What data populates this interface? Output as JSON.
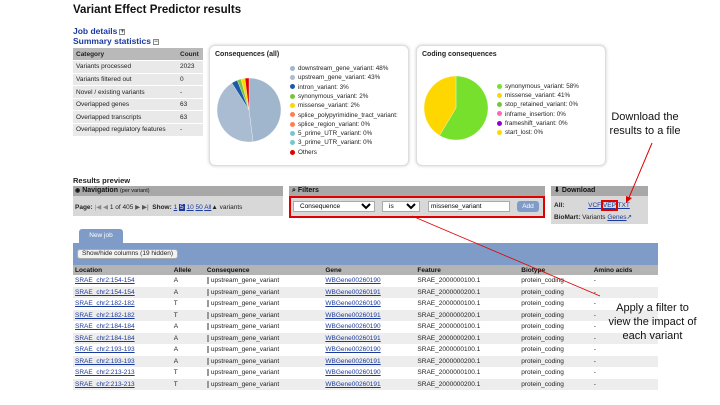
{
  "page_title": "Variant Effect Predictor results",
  "job_details_label": "Job details",
  "summary_label": "Summary statistics",
  "stats": {
    "headers": [
      "Category",
      "Count"
    ],
    "rows": [
      [
        "Variants processed",
        "2023"
      ],
      [
        "Variants filtered out",
        "0"
      ],
      [
        "Novel / existing variants",
        "-"
      ],
      [
        "Overlapped genes",
        "63"
      ],
      [
        "Overlapped transcripts",
        "63"
      ],
      [
        "Overlapped regulatory features",
        "-"
      ]
    ]
  },
  "consequences_all": {
    "title": "Consequences (all)",
    "legend": [
      {
        "label": "downstream_gene_variant: 48%",
        "color": "#9fb6cd"
      },
      {
        "label": "upstream_gene_variant: 43%",
        "color": "#a9bcd1"
      },
      {
        "label": "intron_variant: 3%",
        "color": "#1c5aa8"
      },
      {
        "label": "synonymous_variant: 2%",
        "color": "#76c442"
      },
      {
        "label": "missense_variant: 2%",
        "color": "#ffd700"
      },
      {
        "label": "splice_polypyrimidine_tract_variant:",
        "color": "#ff7f50"
      },
      {
        "label": "splice_region_variant: 0%",
        "color": "#ff7f50"
      },
      {
        "label": "5_prime_UTR_variant: 0%",
        "color": "#7ac5cd"
      },
      {
        "label": "3_prime_UTR_variant: 0%",
        "color": "#7ac5cd"
      },
      {
        "label": "Others",
        "color": "#e00000"
      }
    ],
    "chart_data": {
      "type": "pie",
      "labels": [
        "downstream_gene_variant",
        "upstream_gene_variant",
        "intron_variant",
        "synonymous_variant",
        "missense_variant",
        "Others"
      ],
      "values": [
        48,
        43,
        3,
        2,
        2,
        2
      ]
    }
  },
  "coding_consequences": {
    "title": "Coding consequences",
    "legend": [
      {
        "label": "synonymous_variant: 58%",
        "color": "#76e02c"
      },
      {
        "label": "missense_variant: 41%",
        "color": "#ffd700"
      },
      {
        "label": "stop_retained_variant: 0%",
        "color": "#76c442"
      },
      {
        "label": "inframe_insertion: 0%",
        "color": "#ff69b4"
      },
      {
        "label": "frameshift_variant: 0%",
        "color": "#9400d3"
      },
      {
        "label": "start_lost: 0%",
        "color": "#ffd700"
      }
    ],
    "chart_data": {
      "type": "pie",
      "labels": [
        "synonymous_variant",
        "missense_variant"
      ],
      "values": [
        58,
        41
      ]
    }
  },
  "results_preview_label": "Results preview",
  "navigation": {
    "label": "Navigation",
    "sub": "(per variant)",
    "page_label": "Page:",
    "page_of": "1 of 405",
    "show_label": "Show:",
    "show_options": [
      "1",
      "5",
      "10",
      "50",
      "All"
    ],
    "variants_label": "variants"
  },
  "filters": {
    "label": "Filters",
    "field": "Consequence",
    "operator": "is",
    "value": "missense_variant",
    "add_label": "Add"
  },
  "download": {
    "label": "Download",
    "all_label": "All:",
    "formats": [
      "VCF",
      "VEP",
      "TXT"
    ],
    "biomart_label": "BioMart:",
    "biomart_text": "Variants",
    "biomart_link": "Genes"
  },
  "new_job_label": "New job",
  "show_hide_label": "Show/hide columns (19 hidden)",
  "results_table": {
    "headers": [
      "Location",
      "Allele",
      "Consequence",
      "Gene",
      "Feature",
      "Biotype",
      "Amino acids"
    ],
    "rows": [
      [
        "SRAE_chr2:154-154",
        "A",
        "upstream_gene_variant",
        "WBGene00260190",
        "SRAE_2000000100.1",
        "protein_coding",
        "-"
      ],
      [
        "SRAE_chr2:154-154",
        "A",
        "upstream_gene_variant",
        "WBGene00260191",
        "SRAE_2000000200.1",
        "protein_coding",
        "-"
      ],
      [
        "SRAE_chr2:182-182",
        "T",
        "upstream_gene_variant",
        "WBGene00260190",
        "SRAE_2000000100.1",
        "protein_coding",
        "-"
      ],
      [
        "SRAE_chr2:182-182",
        "T",
        "upstream_gene_variant",
        "WBGene00260191",
        "SRAE_2000000200.1",
        "protein_coding",
        "-"
      ],
      [
        "SRAE_chr2:184-184",
        "A",
        "upstream_gene_variant",
        "WBGene00260190",
        "SRAE_2000000100.1",
        "protein_coding",
        "-"
      ],
      [
        "SRAE_chr2:184-184",
        "A",
        "upstream_gene_variant",
        "WBGene00260191",
        "SRAE_2000000200.1",
        "protein_coding",
        "-"
      ],
      [
        "SRAE_chr2:193-193",
        "A",
        "upstream_gene_variant",
        "WBGene00260190",
        "SRAE_2000000100.1",
        "protein_coding",
        "-"
      ],
      [
        "SRAE_chr2:193-193",
        "A",
        "upstream_gene_variant",
        "WBGene00260191",
        "SRAE_2000000200.1",
        "protein_coding",
        "-"
      ],
      [
        "SRAE_chr2:213-213",
        "T",
        "upstream_gene_variant",
        "WBGene00260190",
        "SRAE_2000000100.1",
        "protein_coding",
        "-"
      ],
      [
        "SRAE_chr2:213-213",
        "T",
        "upstream_gene_variant",
        "WBGene00260191",
        "SRAE_2000000200.1",
        "protein_coding",
        "-"
      ]
    ]
  },
  "annotations": {
    "download": [
      "Download the",
      "results to a file"
    ],
    "filter": [
      "Apply a filter to",
      "view the impact of",
      "each variant"
    ]
  },
  "colors": {
    "highlight_red": "#e00000",
    "link_blue": "#1a3a9c"
  }
}
